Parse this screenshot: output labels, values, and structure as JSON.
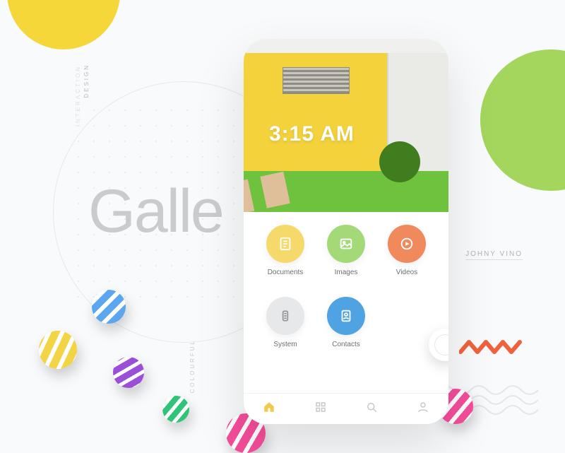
{
  "watermark": "Galle",
  "vertical_labels": {
    "design": "DESIGN",
    "interaction": "INTERACTION",
    "colourful": "COLOURFUL"
  },
  "designer": "JOHNY VINO",
  "hero": {
    "time": "3:15 AM"
  },
  "tiles": [
    {
      "key": "documents",
      "label": "Documents"
    },
    {
      "key": "images",
      "label": "Images"
    },
    {
      "key": "videos",
      "label": "Videos"
    },
    {
      "key": "system",
      "label": "System"
    },
    {
      "key": "contacts",
      "label": "Contacts"
    }
  ],
  "nav": {
    "home": "home",
    "grid": "grid",
    "search": "search",
    "profile": "profile"
  }
}
